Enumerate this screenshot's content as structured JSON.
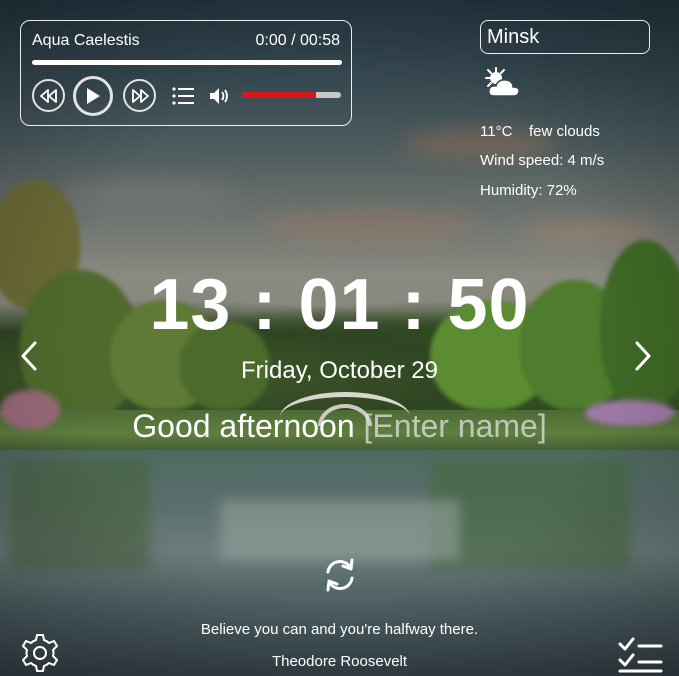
{
  "player": {
    "track_title": "Aqua Caelestis",
    "time_display": "0:00 / 00:58",
    "progress": 0,
    "volume": 0.75,
    "colors": {
      "volume_fill": "#d6161b",
      "volume_track": "#c8c8c8"
    },
    "icons": {
      "prev": "rewind-icon",
      "play": "play-icon",
      "next": "fast-forward-icon",
      "playlist": "playlist-icon",
      "volume": "volume-icon"
    }
  },
  "weather": {
    "city": "Minsk",
    "icon": "few-clouds-icon",
    "temperature": "11°C",
    "description": "few clouds",
    "wind": "Wind speed: 4 m/s",
    "humidity": "Humidity: 72%"
  },
  "clock": {
    "time": "13 : 01 : 50",
    "date": "Friday, October 29"
  },
  "greeting": {
    "text": "Good afternoon",
    "name_placeholder": "[Enter name]"
  },
  "navigation": {
    "prev_icon": "chevron-left-icon",
    "next_icon": "chevron-right-icon"
  },
  "quote": {
    "text": "Believe you can and you're halfway there.",
    "author": "Theodore Roosevelt",
    "refresh_icon": "refresh-icon"
  },
  "footer": {
    "settings_icon": "gear-icon",
    "todo_icon": "checklist-icon"
  }
}
